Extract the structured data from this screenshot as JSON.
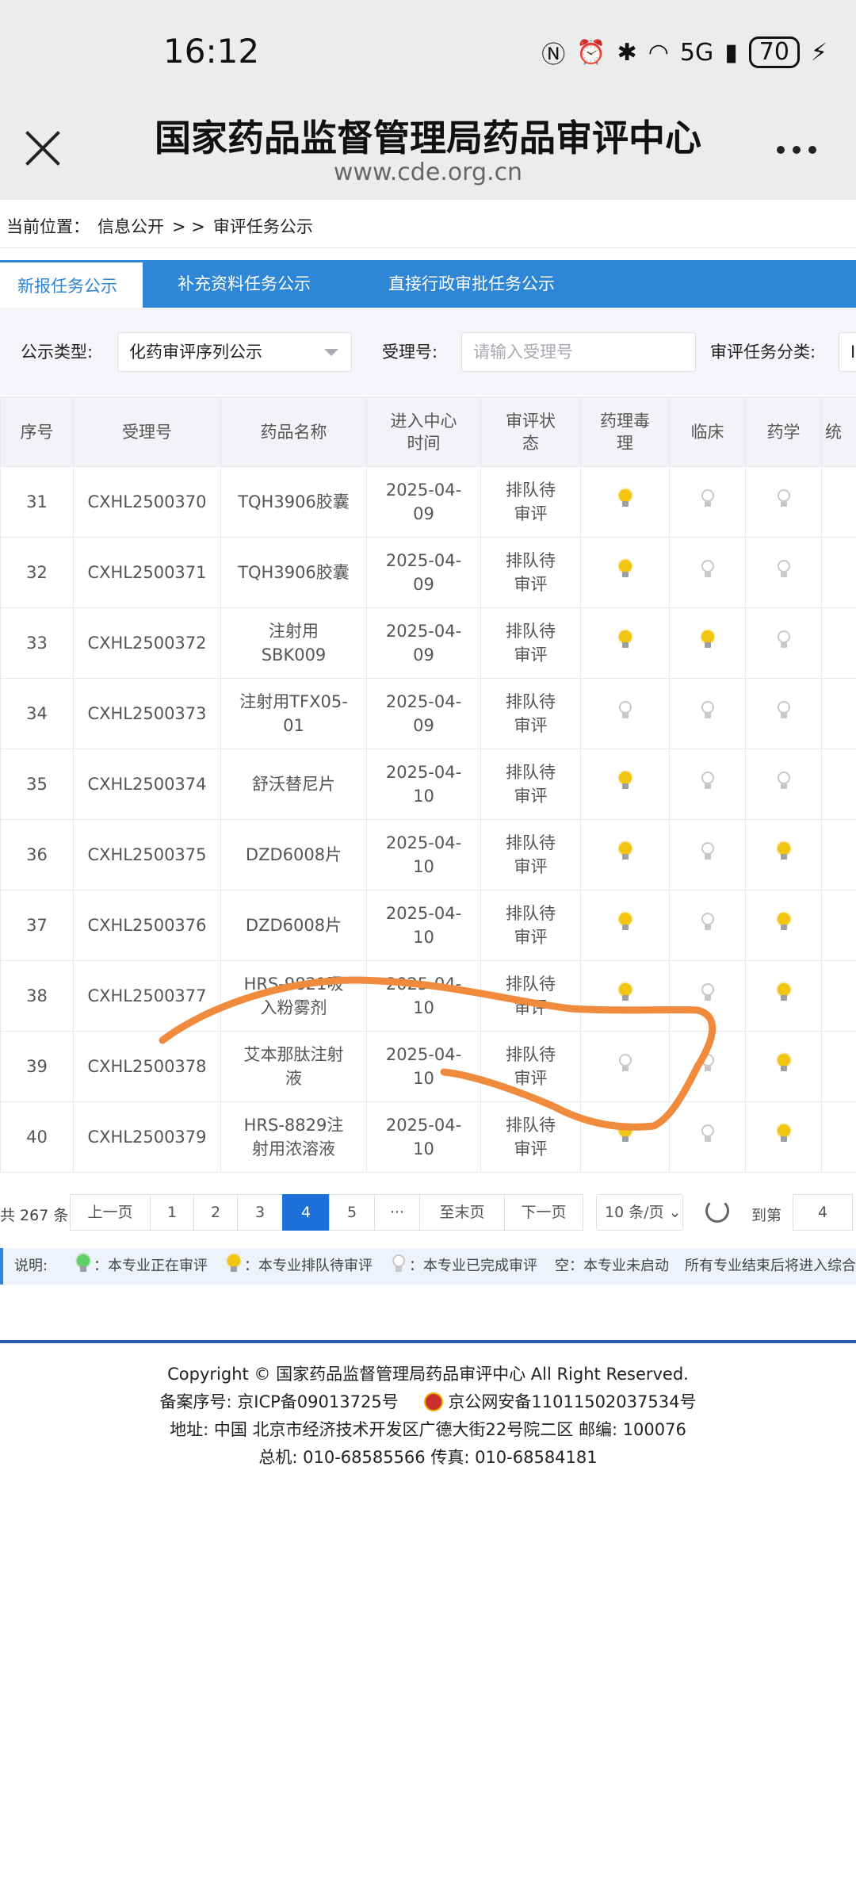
{
  "status_bar": {
    "time": "16:12",
    "network": "5G",
    "battery": "70"
  },
  "browser": {
    "title": "国家药品监督管理局药品审评中心",
    "url": "www.cde.org.cn"
  },
  "breadcrumb": {
    "prefix": "当前位置：",
    "item1": "信息公开",
    "sep": "> >",
    "item2": "审评任务公示"
  },
  "tabs": [
    {
      "label": "新报任务公示"
    },
    {
      "label": "补充资料任务公示"
    },
    {
      "label": "直接行政审批任务公示"
    }
  ],
  "filters": {
    "type_label": "公示类型:",
    "type_value": "化药审评序列公示",
    "accept_label": "受理号:",
    "accept_placeholder": "请输入受理号",
    "category_label": "审评任务分类:",
    "category_value": "I"
  },
  "table": {
    "headers": [
      "序号",
      "受理号",
      "药品名称",
      "进入中心时间",
      "审评状态",
      "药理毒理",
      "临床",
      "药学",
      "统"
    ],
    "header_display": {
      "time": [
        "进入中心",
        "时间"
      ],
      "status": [
        "审评状",
        "态"
      ],
      "pharm": [
        "药理毒",
        "理"
      ]
    },
    "rows": [
      {
        "no": "31",
        "accept": "CXHL2500370",
        "name": [
          "TQH3906胶囊"
        ],
        "date": [
          "2025-04-",
          "09"
        ],
        "status": [
          "排队待",
          "审评"
        ],
        "pt": "on",
        "clin": "off",
        "chem": "off"
      },
      {
        "no": "32",
        "accept": "CXHL2500371",
        "name": [
          "TQH3906胶囊"
        ],
        "date": [
          "2025-04-",
          "09"
        ],
        "status": [
          "排队待",
          "审评"
        ],
        "pt": "on",
        "clin": "off",
        "chem": "off"
      },
      {
        "no": "33",
        "accept": "CXHL2500372",
        "name": [
          "注射用",
          "SBK009"
        ],
        "date": [
          "2025-04-",
          "09"
        ],
        "status": [
          "排队待",
          "审评"
        ],
        "pt": "on",
        "clin": "on",
        "chem": "off"
      },
      {
        "no": "34",
        "accept": "CXHL2500373",
        "name": [
          "注射用TFX05-",
          "01"
        ],
        "date": [
          "2025-04-",
          "09"
        ],
        "status": [
          "排队待",
          "审评"
        ],
        "pt": "off",
        "clin": "off",
        "chem": "off"
      },
      {
        "no": "35",
        "accept": "CXHL2500374",
        "name": [
          "舒沃替尼片"
        ],
        "date": [
          "2025-04-",
          "10"
        ],
        "status": [
          "排队待",
          "审评"
        ],
        "pt": "on",
        "clin": "off",
        "chem": "off"
      },
      {
        "no": "36",
        "accept": "CXHL2500375",
        "name": [
          "DZD6008片"
        ],
        "date": [
          "2025-04-",
          "10"
        ],
        "status": [
          "排队待",
          "审评"
        ],
        "pt": "on",
        "clin": "off",
        "chem": "on"
      },
      {
        "no": "37",
        "accept": "CXHL2500376",
        "name": [
          "DZD6008片"
        ],
        "date": [
          "2025-04-",
          "10"
        ],
        "status": [
          "排队待",
          "审评"
        ],
        "pt": "on",
        "clin": "off",
        "chem": "on"
      },
      {
        "no": "38",
        "accept": "CXHL2500377",
        "name": [
          "HRS-9821吸",
          "入粉雾剂"
        ],
        "date": [
          "2025-04-",
          "10"
        ],
        "status": [
          "排队待",
          "审评"
        ],
        "pt": "on",
        "clin": "off",
        "chem": "on"
      },
      {
        "no": "39",
        "accept": "CXHL2500378",
        "name": [
          "艾本那肽注射",
          "液"
        ],
        "date": [
          "2025-04-",
          "10"
        ],
        "status": [
          "排队待",
          "审评"
        ],
        "pt": "off",
        "clin": "off",
        "chem": "on"
      },
      {
        "no": "40",
        "accept": "CXHL2500379",
        "name": [
          "HRS-8829注",
          "射用浓溶液"
        ],
        "date": [
          "2025-04-",
          "10"
        ],
        "status": [
          "排队待",
          "审评"
        ],
        "pt": "on",
        "clin": "off",
        "chem": "on"
      }
    ]
  },
  "pager": {
    "total": "共 267 条",
    "prev": "上一页",
    "pages": [
      "1",
      "2",
      "3",
      "4",
      "5",
      "···"
    ],
    "current_page": "4",
    "last": "至末页",
    "next": "下一页",
    "page_size": "10 条/页",
    "goto_label": "到第",
    "goto_value": "4"
  },
  "legend": {
    "title": "说明:",
    "green": "本专业正在审评",
    "yellow": "本专业排队待审评",
    "white": "本专业已完成审评",
    "empty": "空：本专业未启动",
    "tail": "所有专业结束后将进入综合"
  },
  "footer": {
    "copyright": "Copyright © 国家药品监督管理局药品审评中心   All Right Reserved.",
    "icp": "备案序号:  京ICP备09013725号",
    "police": "京公网安备11011502037534号",
    "address": "地址:  中国 北京市经济技术开发区广德大街22号院二区      邮编:  100076",
    "contact": "总机:  010-68585566      传真:  010-68584181"
  },
  "colors": {
    "brand_blue": "#2f86d6",
    "page_active": "#1e6fd9",
    "bulb_on": "#f2c511",
    "bulb_active": "#5fd068",
    "annotation": "#f08a3c"
  }
}
